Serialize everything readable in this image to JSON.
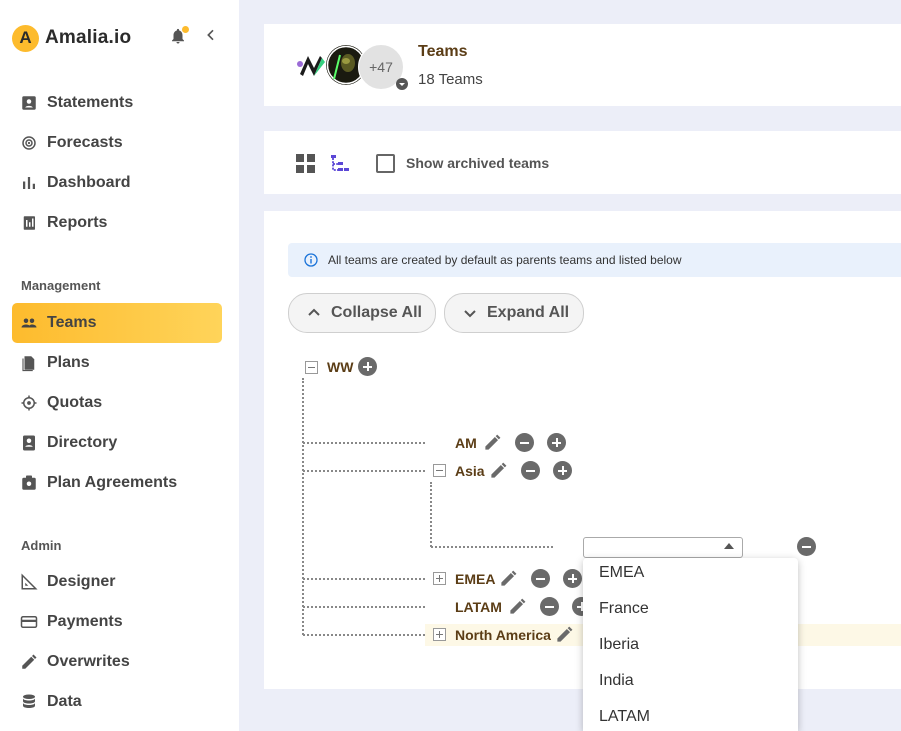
{
  "app": {
    "brand": "Amalia.io",
    "logo_letter": "A"
  },
  "colors": {
    "accent": "#fdbb2d",
    "team_text": "#5b3d16",
    "info_bg": "#e9f1fc"
  },
  "nav": {
    "items": [
      {
        "label": "Statements",
        "icon": "statement-icon"
      },
      {
        "label": "Forecasts",
        "icon": "forecast-icon"
      },
      {
        "label": "Dashboard",
        "icon": "dashboard-icon"
      },
      {
        "label": "Reports",
        "icon": "reports-icon"
      }
    ],
    "management_label": "Management",
    "management": [
      {
        "label": "Teams",
        "icon": "teams-icon",
        "active": true
      },
      {
        "label": "Plans",
        "icon": "plans-icon"
      },
      {
        "label": "Quotas",
        "icon": "quotas-icon"
      },
      {
        "label": "Directory",
        "icon": "directory-icon"
      },
      {
        "label": "Plan Agreements",
        "icon": "plan-agreements-icon"
      }
    ],
    "admin_label": "Admin",
    "admin": [
      {
        "label": "Designer",
        "icon": "designer-icon"
      },
      {
        "label": "Payments",
        "icon": "payments-icon"
      },
      {
        "label": "Overwrites",
        "icon": "overwrites-icon"
      },
      {
        "label": "Data",
        "icon": "data-icon"
      }
    ]
  },
  "header": {
    "title": "Teams",
    "subtitle": "18 Teams",
    "avatar_more": "+47"
  },
  "toolbar": {
    "show_archived_label": "Show archived teams",
    "show_archived_checked": false
  },
  "info": {
    "text": "All teams are created by default as parents teams and listed below"
  },
  "actions": {
    "collapse_all": "Collapse All",
    "expand_all": "Expand All"
  },
  "tree": {
    "root": "WW",
    "nodes": {
      "am": "AM",
      "asia": "Asia",
      "emea": "EMEA",
      "latam": "LATAM",
      "north_america": "North America"
    }
  },
  "dropdown": {
    "selected": "",
    "options": [
      "EMEA",
      "France",
      "Iberia",
      "India",
      "LATAM"
    ]
  }
}
